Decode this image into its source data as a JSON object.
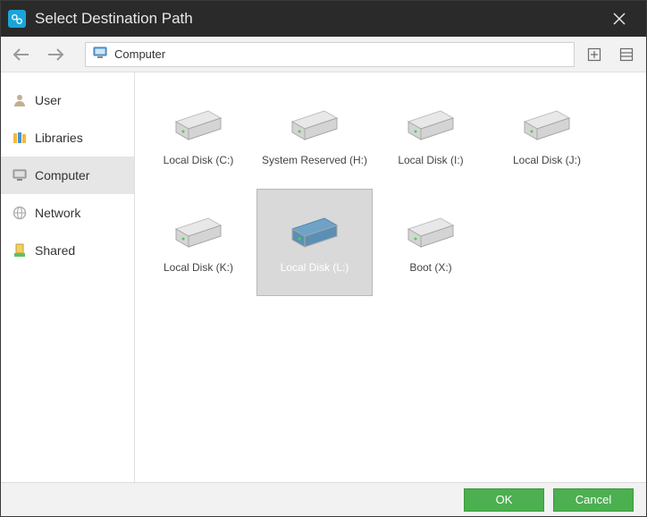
{
  "window": {
    "title": "Select Destination Path"
  },
  "path": {
    "location": "Computer"
  },
  "sidebar": {
    "items": [
      {
        "label": "User"
      },
      {
        "label": "Libraries"
      },
      {
        "label": "Computer"
      },
      {
        "label": "Network"
      },
      {
        "label": "Shared"
      }
    ],
    "selected_index": 2
  },
  "drives": [
    {
      "label": "Local Disk (C:)"
    },
    {
      "label": "System Reserved (H:)"
    },
    {
      "label": "Local Disk (I:)"
    },
    {
      "label": "Local Disk (J:)"
    },
    {
      "label": "Local Disk (K:)"
    },
    {
      "label": "Local Disk (L:)"
    },
    {
      "label": "Boot (X:)"
    }
  ],
  "selected_drive_index": 5,
  "footer": {
    "ok": "OK",
    "cancel": "Cancel"
  }
}
